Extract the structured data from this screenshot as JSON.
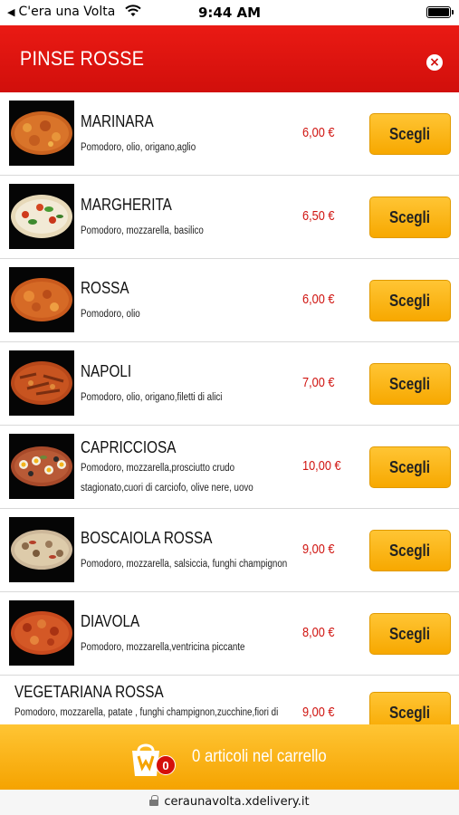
{
  "status_bar": {
    "back_label": "C'era una Volta",
    "time": "9:44 AM"
  },
  "header": {
    "title": "PINSE ROSSE",
    "close_icon": "close-x-circle-icon"
  },
  "menu": {
    "button_label": "Scegli",
    "items": [
      {
        "name": "MARINARA",
        "description": "Pomodoro, olio, origano,aglio",
        "price": "6,00 €",
        "image": "pinsa-marinara-photo"
      },
      {
        "name": "MARGHERITA",
        "description": "Pomodoro, mozzarella, basilico",
        "price": "6,50 €",
        "image": "pinsa-margherita-photo"
      },
      {
        "name": "ROSSA",
        "description": "Pomodoro, olio",
        "price": "6,00 €",
        "image": "pinsa-rossa-photo"
      },
      {
        "name": "NAPOLI",
        "description": "Pomodoro, olio, origano,filetti di alici",
        "price": "7,00 €",
        "image": "pinsa-napoli-photo"
      },
      {
        "name": "CAPRICCIOSA",
        "description": "Pomodoro, mozzarella,prosciutto crudo",
        "description_line2": "stagionato,cuori di carciofo, olive nere, uovo",
        "price": "10,00 €",
        "image": "pinsa-capricciosa-photo"
      },
      {
        "name": "BOSCAIOLA ROSSA",
        "description": "Pomodoro, mozzarella, salsiccia, funghi champignon",
        "price": "9,00 €",
        "image": "pinsa-boscaiola-photo"
      },
      {
        "name": "DIAVOLA",
        "description": "Pomodoro, mozzarella,ventricina piccante",
        "price": "8,00 €",
        "image": "pinsa-diavola-photo"
      },
      {
        "name": "VEGETARIANA ROSSA",
        "description": "Pomodoro, mozzarella, patate , funghi champignon,zucchine,fiori di",
        "price": "9,00 €"
      }
    ]
  },
  "cart": {
    "count": "0",
    "label": "0 articoli nel carrello",
    "icon": "shopping-bag-icon"
  },
  "url_bar": {
    "url": "ceraunavolta.xdelivery.it"
  },
  "colors": {
    "header_red": "#d10f0b",
    "price_red": "#d01511",
    "button_yellow": "#ffc534",
    "cart_yellow": "#f5a300"
  }
}
